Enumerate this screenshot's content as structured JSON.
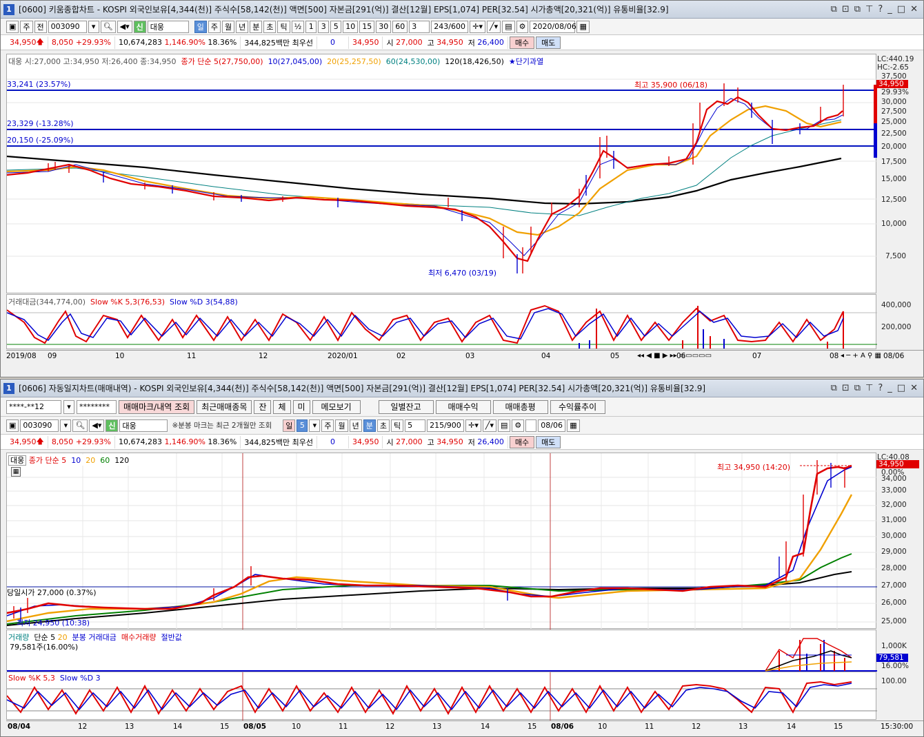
{
  "top": {
    "num": "1",
    "title": "[0600] 키움종합차트 - KOSPI 외국인보유[4,344(천)] 주식수[58,142(천)] 액면[500] 자본금[291(억)] 결산[12월] EPS[1,074] PER[32.54] 시가총액[20,321(억)] 유통비율[32.9]",
    "toolbar": {
      "period_btns": [
        "주",
        "전"
      ],
      "code": "003090",
      "stock_badge": "신",
      "stock_name": "대웅",
      "units": [
        "일",
        "주",
        "월",
        "년",
        "분",
        "초",
        "틱"
      ],
      "unit_selected": "일",
      "fraction": "½",
      "mins": [
        "1",
        "3",
        "5",
        "10",
        "15",
        "30",
        "60"
      ],
      "count_sel": "3",
      "count": "243/600",
      "date": "2020/08/06"
    },
    "quote": {
      "price": "34,950",
      "change": "8,050",
      "pct": "+29.93%",
      "volume": "10,674,283",
      "vol_pct": "1,146.90%",
      "turnover": "18.36%",
      "amount": "344,825백만",
      "pref_label": "최우선",
      "pref_value": "0",
      "bid": "34,950",
      "open_label": "시",
      "open": "27,000",
      "high_label": "고",
      "high": "34,950",
      "low_label": "저",
      "low": "26,400",
      "buy": "매수",
      "sell": "매도"
    },
    "price_chart": {
      "ohlc_legend": "대웅 시:27,000 고:34,950 저:26,400 종:34,950",
      "ma_title": "종가 단순",
      "ma_items": [
        {
          "label": "5(27,750,00)",
          "color": "#e00000"
        },
        {
          "label": "10(27,045,00)",
          "color": "#0000d0"
        },
        {
          "label": "20(25,257,50)",
          "color": "#f0a000"
        },
        {
          "label": "60(24,530,00)",
          "color": "#008080"
        },
        {
          "label": "120(18,426,50)",
          "color": "#000000"
        }
      ],
      "signal": "★단기과열",
      "hlines": [
        "33,241 (23.57%)",
        "23,329 (-13.28%)",
        "20,150 (-25.09%)"
      ],
      "high_mark": "최고 35,900 (06/18)",
      "low_mark": "최저 6,470 (03/19)",
      "lc": "LC:440.19",
      "hc": "HC:-2.65",
      "yticks": [
        "37,500",
        "32,500",
        "30,000",
        "27,500",
        "25,000",
        "22,500",
        "20,000",
        "17,500",
        "15,000",
        "12,500",
        "10,000",
        "7,500"
      ],
      "price_tag": "34,950",
      "pct_tag": "29.93%"
    },
    "sub_chart": {
      "legend_a": "거래대금(344,774,00)",
      "legend_b": "Slow %K 5,3(76,53)",
      "legend_c": "Slow %D 3(54,88)",
      "yticks": [
        "400,000",
        "200,000"
      ]
    },
    "xaxis": [
      "2019/08",
      "09",
      "10",
      "11",
      "12",
      "2020/01",
      "02",
      "03",
      "04",
      "05",
      "06",
      "07",
      "08"
    ],
    "xaxis_right": "08/06"
  },
  "bottom": {
    "num": "1",
    "title": "[0606] 자동일지차트(매매내역) - KOSPI 외국인보유[4,344(천)] 주식수[58,142(천)] 액면[500] 자본금[291(억)] 결산[12월] EPS[1,074] PER[32.54] 시가총액[20,321(억)] 유통비율[32.9]",
    "account": "****-**12",
    "password": "********",
    "btn_mark": "매매마크/내역 조회",
    "btn_recent": "최근매매종목",
    "btn_small": [
      "잔",
      "체",
      "미"
    ],
    "btn_memo": "메모보기",
    "btn_daily": "일별잔고",
    "btn_profit": "매매수익",
    "btn_total": "매매총평",
    "btn_trend": "수익률추이",
    "code": "003090",
    "stock_badge": "신",
    "stock_name": "대웅",
    "notice": "※분봉 마크는 최근 2개월만 조회",
    "units": [
      "일",
      "5",
      "주",
      "월",
      "년",
      "분",
      "초",
      "틱"
    ],
    "min_val": "5",
    "count": "215/900",
    "date": "08/06",
    "quote": {
      "price": "34,950",
      "change": "8,050",
      "pct": "+29.93%",
      "volume": "10,674,283",
      "vol_pct": "1,146.90%",
      "turnover": "18.36%",
      "amount": "344,825백만",
      "pref_label": "최우선",
      "pref_value": "0",
      "bid": "34,950",
      "open_label": "시",
      "open": "27,000",
      "high_label": "고",
      "high": "34,950",
      "low_label": "저",
      "low": "26,400",
      "buy": "매수",
      "sell": "매도"
    },
    "price_chart": {
      "name": "대웅",
      "ma_title": "종가 단순 5",
      "ma_items": [
        {
          "label": "10",
          "color": "#0000d0"
        },
        {
          "label": "20",
          "color": "#f0a000"
        },
        {
          "label": "60",
          "color": "#008000"
        },
        {
          "label": "120",
          "color": "#000000"
        }
      ],
      "open_line": "당일시가 27,000 (0.37%)",
      "low_line": "최저 24,950 (10:38)",
      "high_mark": "최고 34,950 (14:20)",
      "lc": "LC:40.08",
      "price_tag": "34,950",
      "pct_tag": "0.00%",
      "yticks": [
        "34,000",
        "33,000",
        "32,000",
        "31,000",
        "30,000",
        "29,000",
        "28,000",
        "27,000",
        "26,000",
        "25,000"
      ]
    },
    "vol_chart": {
      "legend_a": "거래량",
      "legend_b": "단순 5",
      "legend_c": "20",
      "legend_d": "분봉 거래대금",
      "legend_e": "매수거래량",
      "legend_f": "절반값",
      "sub": "79,581주(16.00%)",
      "yticks": [
        "1,000K"
      ],
      "tag_a": "79,581",
      "tag_b": "16.00%"
    },
    "stoch": {
      "legend_a": "Slow %K 5,3",
      "legend_b": "Slow %D 3",
      "yticks": [
        "100.00"
      ]
    },
    "xaxis": [
      "08/04",
      "12",
      "13",
      "14",
      "15",
      "08/05",
      "10",
      "11",
      "12",
      "13",
      "14",
      "15",
      "08/06",
      "10",
      "11",
      "12",
      "13",
      "14",
      "15"
    ],
    "xaxis_right": "15:30:00"
  }
}
